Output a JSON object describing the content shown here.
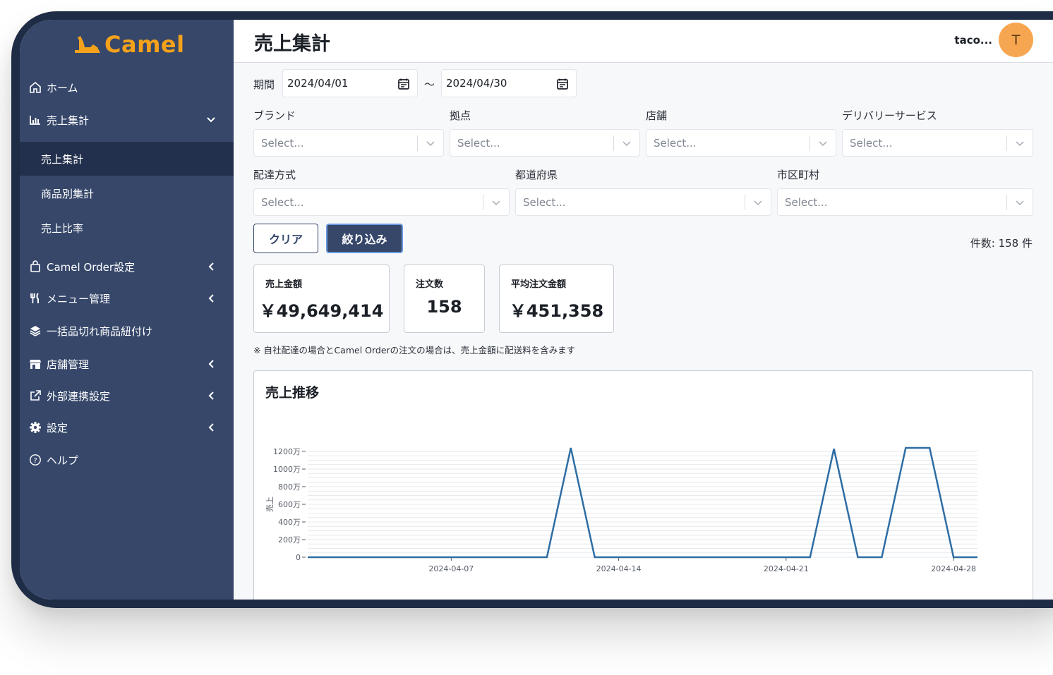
{
  "app": {
    "logo_text": "Camel",
    "brand_color": "#f5a21b"
  },
  "sidebar": {
    "items": [
      {
        "label": "ホーム",
        "icon": "home-icon"
      },
      {
        "label": "売上集計",
        "icon": "bar-chart-icon",
        "expanded": true,
        "children": [
          {
            "label": "売上集計",
            "active": true
          },
          {
            "label": "商品別集計"
          },
          {
            "label": "売上比率"
          }
        ]
      },
      {
        "label": "Camel Order設定",
        "icon": "shopping-bag-icon"
      },
      {
        "label": "メニュー管理",
        "icon": "utensils-icon"
      },
      {
        "label": "一括品切れ商品紐付け",
        "icon": "layers-icon"
      },
      {
        "label": "店舗管理",
        "icon": "store-icon"
      },
      {
        "label": "外部連携設定",
        "icon": "external-link-icon"
      },
      {
        "label": "設定",
        "icon": "gear-icon"
      },
      {
        "label": "ヘルプ",
        "icon": "help-circle-icon"
      }
    ]
  },
  "header": {
    "title": "売上集計",
    "user_name": "taco...",
    "avatar_initial": "T",
    "avatar_color": "#f6a651"
  },
  "filters": {
    "period_label": "期間",
    "date_from": "2024/04/01",
    "date_separator": "〜",
    "date_to": "2024/04/30",
    "row1": [
      {
        "label": "ブランド",
        "placeholder": "Select..."
      },
      {
        "label": "拠点",
        "placeholder": "Select..."
      },
      {
        "label": "店舗",
        "placeholder": "Select..."
      },
      {
        "label": "デリバリーサービス",
        "placeholder": "Select..."
      }
    ],
    "row2": [
      {
        "label": "配達方式",
        "placeholder": "Select..."
      },
      {
        "label": "都道府県",
        "placeholder": "Select..."
      },
      {
        "label": "市区町村",
        "placeholder": "Select..."
      }
    ],
    "clear_label": "クリア",
    "apply_label": "絞り込み",
    "count_text": "件数: 158 件"
  },
  "summary": [
    {
      "title": "売上金額",
      "value": "￥49,649,414"
    },
    {
      "title": "注文数",
      "value": "158"
    },
    {
      "title": "平均注文金額",
      "value": "￥451,358"
    }
  ],
  "note": "※ 自社配達の場合とCamel Orderの注文の場合は、売上金額に配送料を含みます",
  "chart_data": {
    "type": "line",
    "title": "売上推移",
    "xlabel": "",
    "ylabel": "売上",
    "x": [
      "2024-04-01",
      "2024-04-02",
      "2024-04-03",
      "2024-04-04",
      "2024-04-05",
      "2024-04-06",
      "2024-04-07",
      "2024-04-08",
      "2024-04-09",
      "2024-04-10",
      "2024-04-11",
      "2024-04-12",
      "2024-04-13",
      "2024-04-14",
      "2024-04-15",
      "2024-04-16",
      "2024-04-17",
      "2024-04-18",
      "2024-04-19",
      "2024-04-20",
      "2024-04-21",
      "2024-04-22",
      "2024-04-23",
      "2024-04-24",
      "2024-04-25",
      "2024-04-26",
      "2024-04-27",
      "2024-04-28",
      "2024-04-29"
    ],
    "series": [
      {
        "color": "#2e6da4",
        "values": [
          0,
          0,
          0,
          0,
          0,
          0,
          0,
          0,
          0,
          0,
          0,
          12400000,
          0,
          0,
          0,
          0,
          0,
          3000,
          0,
          0,
          0,
          0,
          12300000,
          0,
          0,
          12400000,
          12400000,
          0,
          0
        ]
      }
    ],
    "yticks": [
      0,
      2000000,
      4000000,
      6000000,
      8000000,
      10000000,
      12000000
    ],
    "ytick_labels": [
      "0",
      "200万",
      "400万",
      "600万",
      "800万",
      "1000万",
      "1200万"
    ],
    "xticks": [
      "2024-04-07",
      "2024-04-14",
      "2024-04-21",
      "2024-04-28"
    ],
    "ylim": [
      0,
      12000000
    ],
    "grid": true
  }
}
